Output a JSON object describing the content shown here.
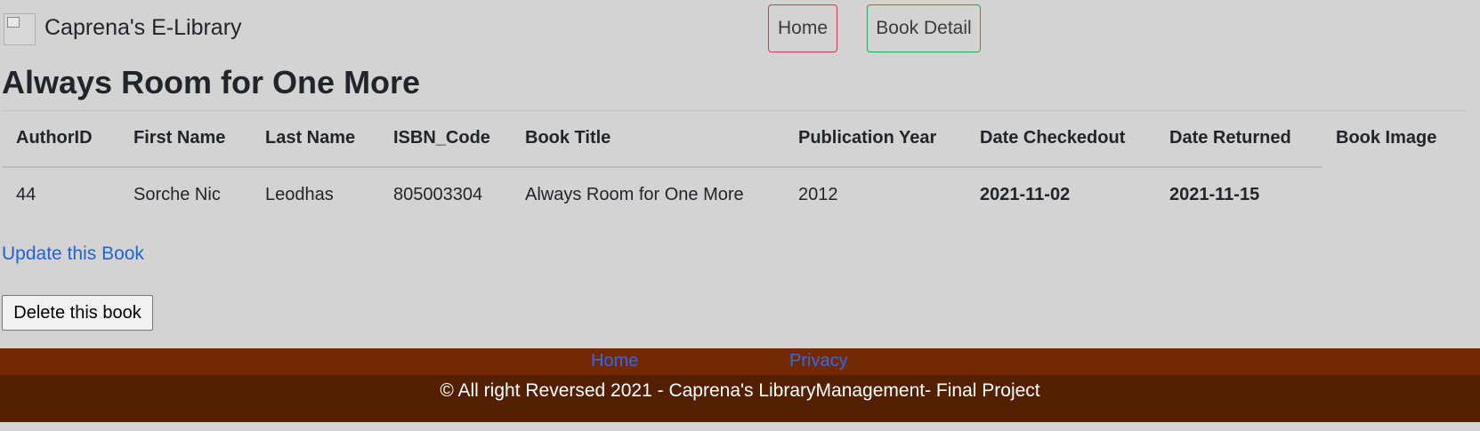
{
  "header": {
    "brand": "Caprena's E-Library",
    "nav": {
      "home": "Home",
      "book_detail": "Book Detail"
    }
  },
  "page": {
    "title": "Always Room for One More"
  },
  "table": {
    "columns": [
      "AuthorID",
      "First Name",
      "Last Name",
      "ISBN_Code",
      "Book Title",
      "Publication Year",
      "Date Checkedout",
      "Date Returned",
      "Book Image"
    ],
    "row": {
      "author_id": "44",
      "first_name": "Sorche Nic",
      "last_name": "Leodhas",
      "isbn": "805003304",
      "book_title": "Always Room for One More",
      "publication_year": "2012",
      "date_checkedout": "2021-11-02",
      "date_returned": "2021-11-15",
      "book_image": ""
    }
  },
  "actions": {
    "update_link": "Update this Book",
    "delete_button": "Delete this book"
  },
  "footer": {
    "links": {
      "home": "Home",
      "privacy": "Privacy"
    },
    "copyright": "© All right Reversed 2021 - Caprena's LibraryManagement- Final Project"
  },
  "colors": {
    "background": "#d3d3d3",
    "home_border": "#dc3545",
    "detail_border": "#28a745",
    "link": "#1e63d6",
    "footer_links_bg": "#722803",
    "footer_bg": "#521f01"
  }
}
